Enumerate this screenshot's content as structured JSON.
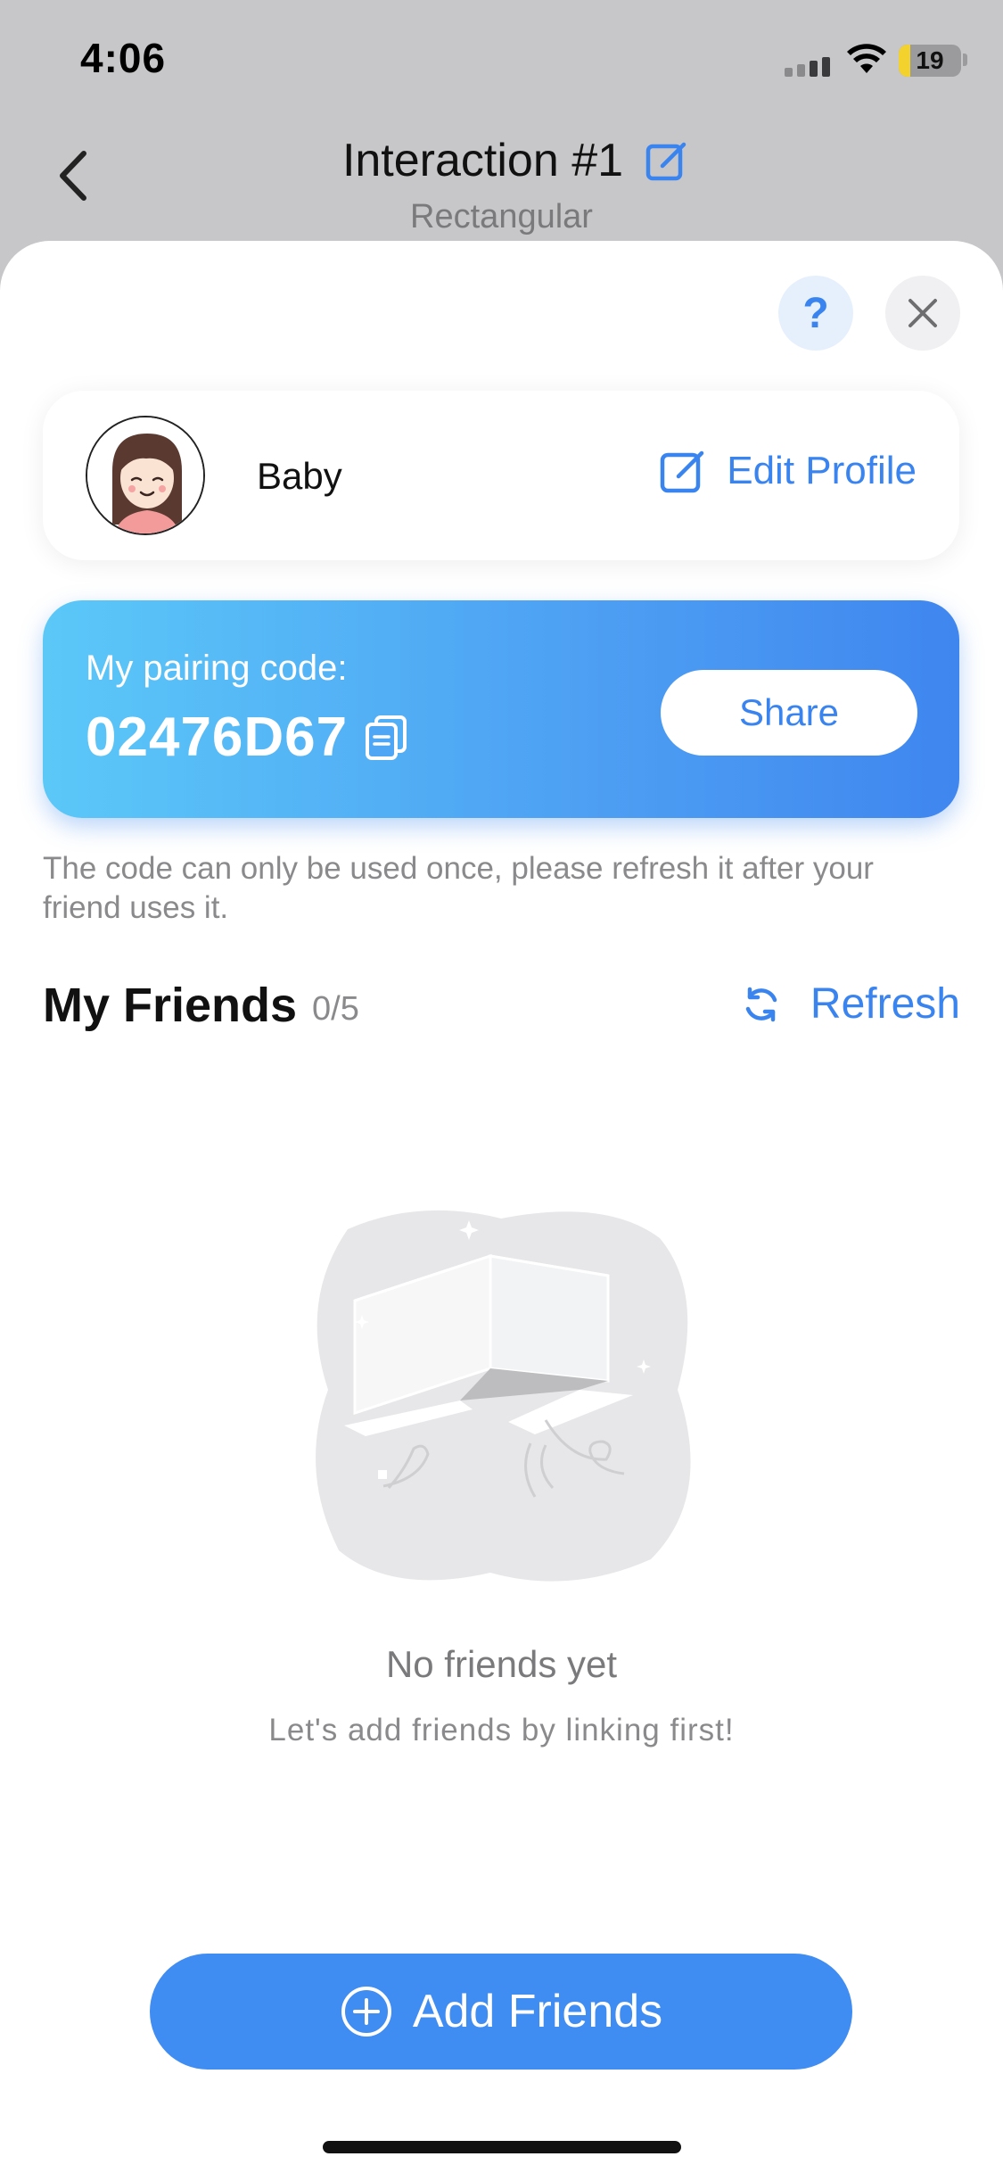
{
  "status_bar": {
    "time": "4:06",
    "battery": "19",
    "battery_level": 0.19,
    "battery_color": "#f4d22e"
  },
  "nav": {
    "title": "Interaction #1",
    "subtitle": "Rectangular"
  },
  "sheet": {
    "help_label": "?",
    "profile": {
      "name": "Baby",
      "edit_label": "Edit Profile"
    },
    "pairing": {
      "label": "My pairing code:",
      "code": "02476D67",
      "share_label": "Share"
    },
    "note": "The code can only be used once, please refresh it after your friend uses it.",
    "friends": {
      "title": "My Friends",
      "count": "0/5",
      "refresh_label": "Refresh"
    },
    "empty": {
      "title": "No friends yet",
      "subtitle": "Let's add friends by linking first!"
    },
    "add_button_label": "Add Friends"
  },
  "colors": {
    "accent": "#3a84f0",
    "gradient_start": "#5bc8f8",
    "gradient_end": "#3f86ef"
  }
}
